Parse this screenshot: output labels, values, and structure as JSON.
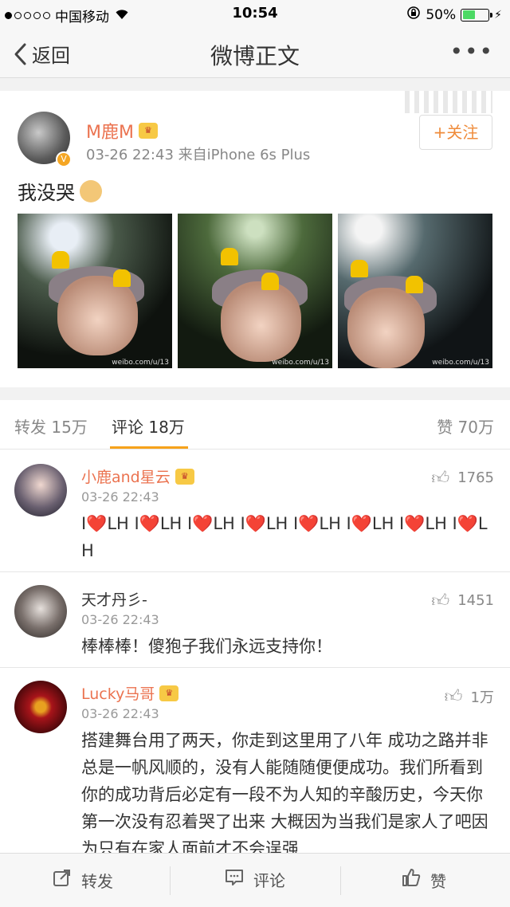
{
  "status_bar": {
    "carrier": "中国移动",
    "time": "10:54",
    "battery": "50%",
    "battery_level": 0.5
  },
  "nav": {
    "back_label": "返回",
    "title": "微博正文",
    "more_icon": "more-dots-icon"
  },
  "post": {
    "username": "M鹿M",
    "meta": "03-26 22:43   来自iPhone 6s Plus",
    "follow_label": "+关注",
    "text": "我没哭"
  },
  "tabs": {
    "repost": "转发 15万",
    "comment": "评论 18万",
    "like": "赞 70万"
  },
  "comments": [
    {
      "name": "小鹿and星云",
      "time": "03-26 22:43",
      "likes": "1765",
      "body": "I❤️LH I❤️LH I❤️LH I❤️LH  I❤️LH I❤️LH  I❤️LH I❤️LH"
    },
    {
      "name": "天才丹彡-",
      "time": "03-26 22:43",
      "likes": "1451",
      "body": "棒棒棒！傻狍子我们永远支持你！"
    },
    {
      "name": "Lucky马哥",
      "time": "03-26 22:43",
      "likes": "1万",
      "body": "搭建舞台用了两天，你走到这里用了八年 成功之路并非总是一帆风顺的，没有人能随随便便成功。我们所看到你的成功背后必定有一段不为人知的辛酸历史，今天你第一次没有忍着哭了出来 大概因为当我们是家人了吧因为只有在家人面前才不会逞强"
    }
  ],
  "bottom_bar": {
    "repost": "转发",
    "comment": "评论",
    "like": "赞"
  },
  "colors": {
    "accent": "#eb7350",
    "tab_underline": "#f7a21b",
    "follow": "#ef8b3a"
  }
}
